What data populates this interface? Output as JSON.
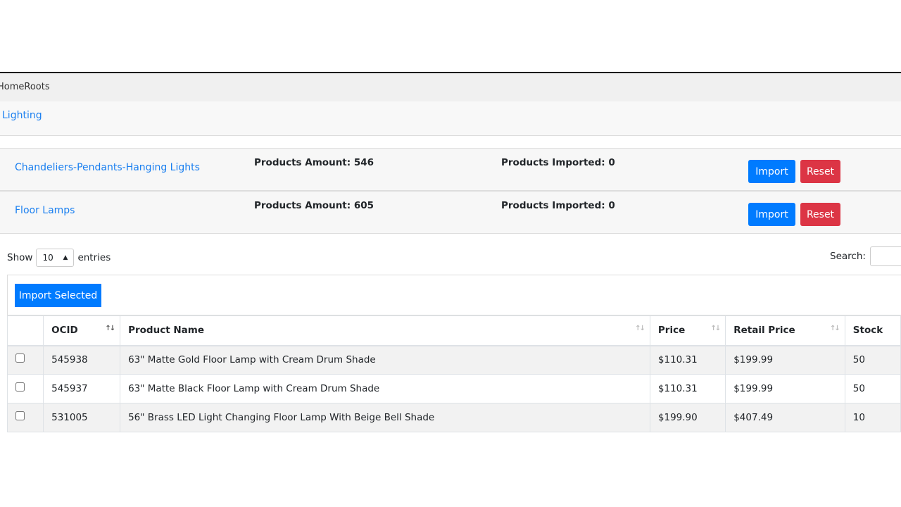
{
  "brand": "HomeRoots",
  "category": "Lighting",
  "subcategories": [
    {
      "name": "Chandeliers-Pendants-Hanging Lights",
      "amount": "Products Amount: 546",
      "imported": "Products Imported: 0",
      "import_label": "Import",
      "reset_label": "Reset"
    },
    {
      "name": "Floor Lamps",
      "amount": "Products Amount: 605",
      "imported": "Products Imported: 0",
      "import_label": "Import",
      "reset_label": "Reset"
    }
  ],
  "table_controls": {
    "show": "Show",
    "entries_value": "10",
    "entries": "entries",
    "search_label": "Search:",
    "search_value": "",
    "import_selected": "Import Selected"
  },
  "table": {
    "headers": [
      "OCID",
      "Product Name",
      "Price",
      "Retail Price",
      "Stock"
    ],
    "rows": [
      {
        "ocid": "545938",
        "name": "63\" Matte Gold Floor Lamp with Cream Drum Shade",
        "price": "$110.31",
        "retail": "$199.99",
        "stock": "50"
      },
      {
        "ocid": "545937",
        "name": "63\" Matte Black Floor Lamp with Cream Drum Shade",
        "price": "$110.31",
        "retail": "$199.99",
        "stock": "50"
      },
      {
        "ocid": "531005",
        "name": "56\" Brass LED Light Changing Floor Lamp With Beige Bell Shade",
        "price": "$199.90",
        "retail": "$407.49",
        "stock": "10"
      }
    ]
  },
  "colors": {
    "primary": "#007bff",
    "danger": "#dc3545",
    "link": "#1a7ff0"
  }
}
